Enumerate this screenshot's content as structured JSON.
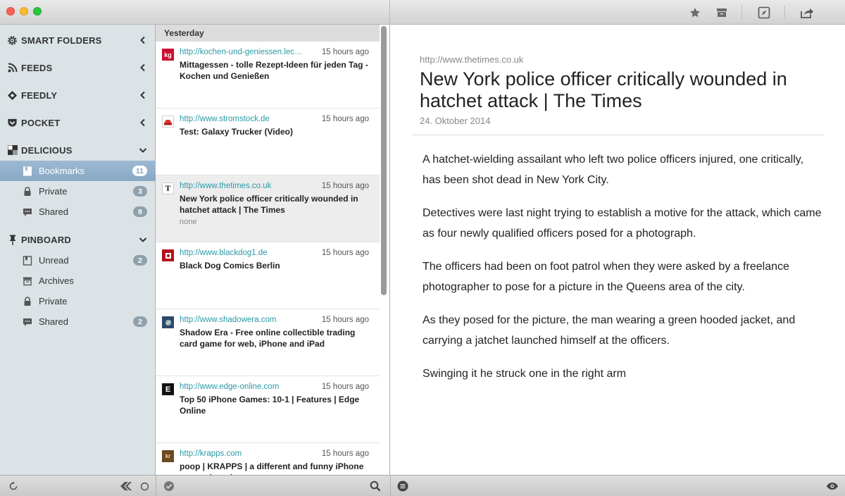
{
  "toolbar": {
    "icons": [
      "star-icon",
      "archive-icon",
      "compass-icon",
      "share-icon"
    ]
  },
  "sidebar": {
    "sections": [
      {
        "label": "SMART FOLDERS",
        "icon": "gear-icon",
        "expanded": false
      },
      {
        "label": "FEEDS",
        "icon": "rss-icon",
        "expanded": false
      },
      {
        "label": "FEEDLY",
        "icon": "feedly-icon",
        "expanded": false
      },
      {
        "label": "POCKET",
        "icon": "pocket-icon",
        "expanded": false
      },
      {
        "label": "DELICIOUS",
        "icon": "delicious-icon",
        "expanded": true
      },
      {
        "label": "PINBOARD",
        "icon": "pin-icon",
        "expanded": true
      }
    ],
    "delicious_items": [
      {
        "label": "Bookmarks",
        "count": "11",
        "icon": "bookmark-icon"
      },
      {
        "label": "Private",
        "count": "3",
        "icon": "lock-icon"
      },
      {
        "label": "Shared",
        "count": "8",
        "icon": "chat-icon"
      }
    ],
    "pinboard_items": [
      {
        "label": "Unread",
        "count": "2",
        "icon": "bookmark-icon"
      },
      {
        "label": "Archives",
        "count": "",
        "icon": "archive-icon"
      },
      {
        "label": "Private",
        "count": "",
        "icon": "lock-icon"
      },
      {
        "label": "Shared",
        "count": "2",
        "icon": "chat-icon"
      }
    ]
  },
  "list": {
    "group_header": "Yesterday",
    "articles": [
      {
        "url": "http://kochen-und-geniessen.lec…",
        "time": "15 hours ago",
        "title": "Mittagessen - tolle Rezept-Ideen für jeden Tag - Kochen und Genießen",
        "extra": "",
        "favicon": "kg"
      },
      {
        "url": "http://www.stromstock.de",
        "time": "15 hours ago",
        "title": "Test: Galaxy Trucker (Video)",
        "extra": "",
        "favicon": ""
      },
      {
        "url": "http://www.thetimes.co.uk",
        "time": "15 hours ago",
        "title": "New York police officer critically wounded in hatchet attack | The Times",
        "extra": "none",
        "favicon": "T"
      },
      {
        "url": "http://www.blackdog1.de",
        "time": "15 hours ago",
        "title": "Black Dog Comics Berlin",
        "extra": "",
        "favicon": ""
      },
      {
        "url": "http://www.shadowera.com",
        "time": "15 hours ago",
        "title": "Shadow Era - Free online collectible trading card game for web, iPhone and iPad",
        "extra": "",
        "favicon": ""
      },
      {
        "url": "http://www.edge-online.com",
        "time": "15 hours ago",
        "title": "Top 50 iPhone Games: 10-1 | Features | Edge Online",
        "extra": "",
        "favicon": "E"
      },
      {
        "url": "http://krapps.com",
        "time": "15 hours ago",
        "title": "poop | KRAPPS | a different and funny iPhone app review site",
        "extra": "",
        "favicon": "kr"
      }
    ]
  },
  "reader": {
    "source": "http://www.thetimes.co.uk",
    "title": "New York police officer critically wounded in hatchet attack | The Times",
    "date": "24. Oktober 2014",
    "paragraphs": [
      "A hatchet-wielding assailant who left two police officers injured, one critically, has been shot dead in New York City.",
      "Detectives were last night trying to establish a motive for the attack, which came as four newly qualified officers posed for a photograph.",
      "The officers had been on foot patrol when they were asked by a freelance photographer to pose for a picture in the Queens area of the city.",
      "As they posed for the picture, the man wearing a green hooded jacket, and carrying a jatchet launched himself at the officers.",
      "Swinging it he struck one in the right arm"
    ]
  },
  "colors": {
    "accent_link": "#2b9aa6",
    "sidebar_bg": "#dce3e7",
    "selected_sidebar": "#8fadc8",
    "badge": "#8fa1ad"
  }
}
